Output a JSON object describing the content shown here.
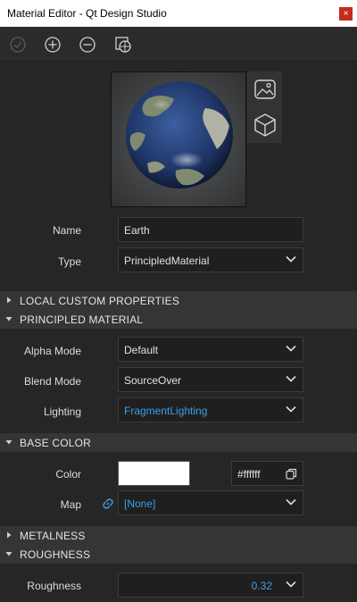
{
  "window": {
    "title": "Material Editor - Qt Design Studio",
    "close_glyph": "×"
  },
  "toolbar": {
    "buttons": [
      {
        "name": "apply",
        "icon": "check-circle-icon",
        "enabled": false
      },
      {
        "name": "add",
        "icon": "plus-circle-icon",
        "enabled": true
      },
      {
        "name": "remove",
        "icon": "minus-circle-icon",
        "enabled": true
      },
      {
        "name": "create-bundle",
        "icon": "material-browser-icon",
        "enabled": true
      }
    ]
  },
  "preview": {
    "env_button_icon": "image-icon",
    "model_button_icon": "cube-icon"
  },
  "properties": {
    "name_label": "Name",
    "name_value": "Earth",
    "type_label": "Type",
    "type_value": "PrincipledMaterial"
  },
  "sections": {
    "local_custom": "LOCAL CUSTOM PROPERTIES",
    "principled": "PRINCIPLED MATERIAL",
    "base_color": "BASE COLOR",
    "metalness": "METALNESS",
    "roughness": "ROUGHNESS"
  },
  "principled": {
    "alpha_mode_label": "Alpha Mode",
    "alpha_mode_value": "Default",
    "blend_mode_label": "Blend Mode",
    "blend_mode_value": "SourceOver",
    "lighting_label": "Lighting",
    "lighting_value": "FragmentLighting"
  },
  "base_color": {
    "color_label": "Color",
    "color_value": "#ffffff",
    "map_label": "Map",
    "map_value": "[None]"
  },
  "roughness": {
    "label": "Roughness",
    "value": "0.32"
  },
  "colors": {
    "background": "#262626",
    "section_header": "#353535",
    "accent": "#3c9fe6",
    "close_button": "#c42b1c"
  }
}
